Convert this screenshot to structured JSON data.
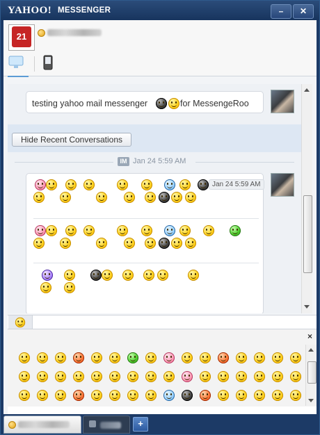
{
  "window": {
    "logo_text": "YAHOO!",
    "app_name": "MESSENGER",
    "minimize_label": "–",
    "close_label": "✕"
  },
  "conversation": {
    "message1_text": "testing yahoo mail messenger",
    "message1_suffix": "for MessengeRoo",
    "hide_recent_label": "Hide Recent Conversations",
    "im_badge": "IM",
    "date_separator": "Jan 24 5:59 AM",
    "timestamp": "Jan 24 5:59 AM"
  },
  "picker": {
    "close_label": "×"
  },
  "bottombar": {
    "add_label": "+"
  },
  "colors": {
    "titlebar": "#17345e",
    "accent": "#5b9bd5",
    "status": "#e3a414"
  },
  "icons": [
    "avatar",
    "status-dot-icon",
    "chat-mode-icon",
    "mobile-mode-icon",
    "smiley-tab-icon",
    "close-icon",
    "add-tab-icon"
  ]
}
